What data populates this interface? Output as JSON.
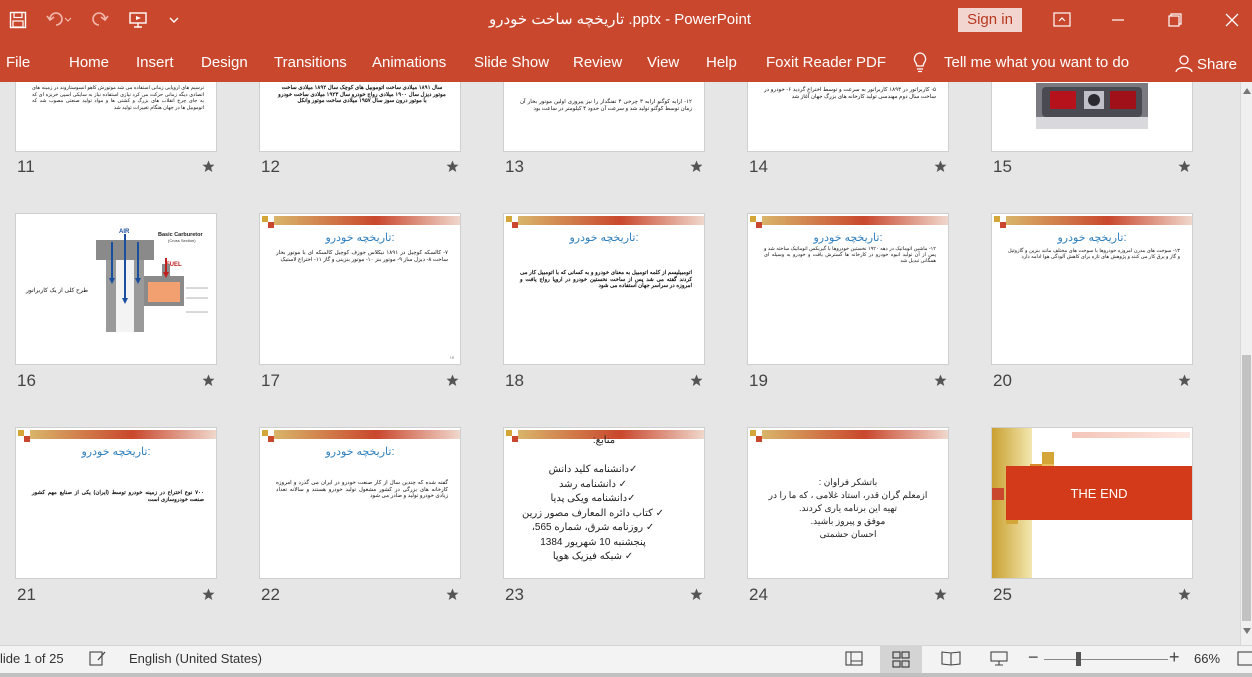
{
  "window": {
    "title": "تاریخچه ساخت خودرو .pptx - PowerPoint",
    "sign_in_label": "Sign in"
  },
  "ribbon": {
    "tabs": [
      "File",
      "Home",
      "Insert",
      "Design",
      "Transitions",
      "Animations",
      "Slide Show",
      "Review",
      "View",
      "Help",
      "Foxit Reader PDF"
    ],
    "tell_me": "Tell me what you want to do",
    "share_label": "Share"
  },
  "slides": {
    "s11": {
      "num": "11",
      "body": "ترسیم های اروپایی زمانی استفاده می شد موتورش کاهو انسوستاروند در زمینه های اتصادی دیگه زمانی حرکت می کرد نیازی استفاده نیاز به سایکی اسپی خربزه ای که به جای چرخ انقلاب های بزرگ و کشتی ها و مواد تولید صنعتی مصوب شد که اتوموبیل ها در جهان هنگام تغییرات تولید شد"
    },
    "s12": {
      "num": "12",
      "body": "سال ۱۸۹۱ میلادی ساخت اتوموبیل های کوچک سال ۱۸۹۲ میلادی ساخت موتور دیزل سال ۱۹۰۰ میلادی رواج خودرو سال ۱۹۲۳ میلادی ساخت خودرو با موتور درون سوز سال ۱۹۵۷ میلادی ساخت موتور وانکل"
    },
    "s13": {
      "num": "13",
      "body": "۱۲- ارابه کوگنو ارابه ۳ چرخی ۴ تفنگدار را نیز پیروزی اولین موتور بخار آن زمان توسط کوگنو تولید شد و سرعت آن حدود ۴ کیلومتر در ساعت بود"
    },
    "s14": {
      "num": "14",
      "body": "۵- کاربراتور در ۱۸۹۳ کاربراتور به سرعت و توسط اختراع گردید ۶- خودرو در ساخت سال دوم مهندسی تولید کارخانه های بزرگ جهان آغاز شد"
    },
    "s15": {
      "num": "15"
    },
    "s16": {
      "num": "16",
      "caption": "طرح کلی از یک کاربراتور",
      "diagram_title": "Basic Carburetor",
      "diagram_subtitle": "(Cross Section)",
      "air_label": "AIR",
      "fuel_label": "FUEL"
    },
    "s17": {
      "num": "17",
      "title": "تاریخچه خودرو:",
      "body": "۷- کالسکه کوچیل در ۱۸۹۱ نیکلاس جوزف کوچیل کالسکه ای با موتور بخار ساخت ۸- دیزل ساز ۹- موتور بنز ۱۰- موتور بنزینی و گاز ۱۱- اختراع لاستیک"
    },
    "s18": {
      "num": "18",
      "title": "تاریخچه خودرو:",
      "body": "اتومبیلیسم از کلمه اتومبیل به معنای خودرو و به کسانی که با اتومبیل کار می کردند گفته می شد پس از ساخت نخستین خودرو در اروپا رواج یافت و امروزه در سراسر جهان استفاده می شود"
    },
    "s19": {
      "num": "19",
      "title": "تاریخچه خودرو:",
      "body": "۱۲- ماشین اتوماتیک در دهه ۱۹۲۰ نخستین خودروها با گیربکس اتوماتیک ساخته شد و پس از آن تولید انبوه خودرو در کارخانه ها گسترش یافت و خودرو به وسیله ای همگانی تبدیل شد"
    },
    "s20": {
      "num": "20",
      "title": "تاریخچه خودرو:",
      "body": "۱۳- سوخت های مدرن امروزه خودروها با سوخت های مختلف مانند بنزین و گازوئیل و گاز و برق کار می کنند و پژوهش های تازه برای کاهش آلودگی هوا ادامه دارد"
    },
    "s21": {
      "num": "21",
      "title": "تاریخچه خودرو:",
      "body": "۷۰۰ نوع اختراع در زمینه خودرو توسط (ایران) یکی از صنایع مهم کشور صنعت خودروسازی است"
    },
    "s22": {
      "num": "22",
      "title": "تاریخچه خودرو:",
      "body": "گفته شده که چندین سال از کار صنعت خودرو در ایران می گذرد و امروزه کارخانه های بزرگی در کشور مشغول تولید خودرو هستند و سالانه تعداد زیادی خودرو تولید و صادر می شود"
    },
    "s23": {
      "num": "23",
      "title": "منابع:",
      "lines": [
        "✓دانشنامه کلید دانش",
        "✓ دانشنامه رشد",
        "✓دانشنامه ویکی پدیا",
        "✓ کتاب دائره المعارف مصور زرین",
        "✓ روزنامه شرق، شماره 565، پنجشنبه 10 شهریور 1384",
        "✓ شبکه فیزیک هوپا"
      ]
    },
    "s24": {
      "num": "24",
      "lines": [
        "باتشکر فراوان :",
        "ازمعلم گران قدر، استاد غلامی ، که ما را در",
        "تهیه این برنامه یاری کردند.",
        "موفق و پیروز باشید.",
        "احسان حشمتی"
      ]
    },
    "s25": {
      "num": "25",
      "end_text": "THE END"
    }
  },
  "status": {
    "slide_info": "lide 1 of 25",
    "language": "English (United States)",
    "zoom": "66%"
  },
  "colors": {
    "accent": "#c9472d",
    "title_blue": "#2e7fbd",
    "end_red": "#d23a1a"
  }
}
